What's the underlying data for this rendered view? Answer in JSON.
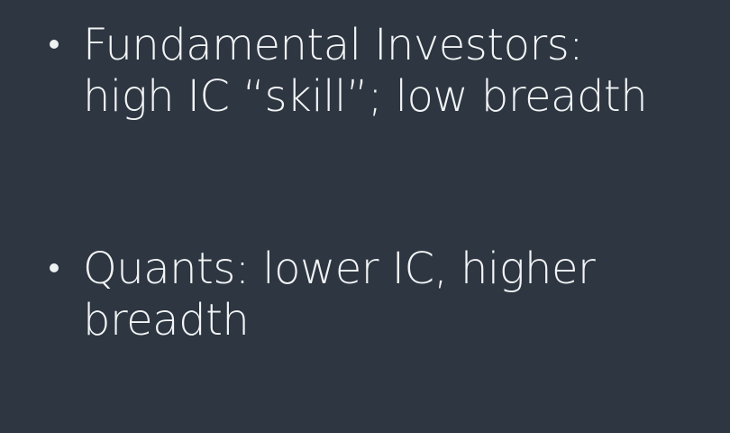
{
  "slide": {
    "bullets": [
      {
        "lines": [
          "Fundamental Investors:",
          "high IC “skill”; low breadth"
        ]
      },
      {
        "lines": [
          "Quants: lower IC, higher",
          "breadth"
        ]
      }
    ]
  }
}
